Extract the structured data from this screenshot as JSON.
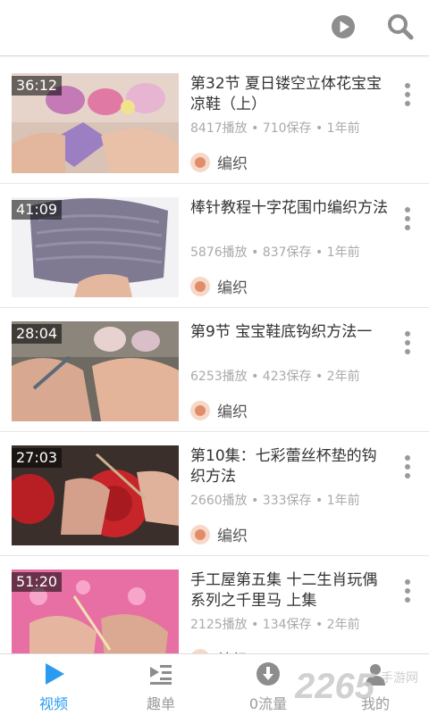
{
  "videos": [
    {
      "duration": "36:12",
      "title": "第32节 夏日镂空立体花宝宝凉鞋（上）",
      "stats": "8417播放 • 710保存 • 1年前",
      "author": "编织"
    },
    {
      "duration": "41:09",
      "title": "棒针教程十字花围巾编织方法",
      "stats": "5876播放 • 837保存 • 1年前",
      "author": "编织"
    },
    {
      "duration": "28:04",
      "title": "第9节 宝宝鞋底钩织方法一",
      "stats": "6253播放 • 423保存 • 2年前",
      "author": "编织"
    },
    {
      "duration": "27:03",
      "title": "第10集：七彩蕾丝杯垫的钩织方法",
      "stats": "2660播放 • 333保存 • 1年前",
      "author": "编织"
    },
    {
      "duration": "51:20",
      "title": "手工屋第五集 十二生肖玩偶系列之千里马 上集",
      "stats": "2125播放 • 134保存 • 2年前",
      "author": "编织"
    }
  ],
  "tabs": [
    {
      "label": "视频"
    },
    {
      "label": "趣单"
    },
    {
      "label": "0流量"
    },
    {
      "label": "我的"
    }
  ],
  "watermark": {
    "brand": "2265",
    "suffix": "手游网"
  },
  "colors": {
    "accent": "#2b9bf1",
    "icon_gray": "#8d8d8d"
  }
}
